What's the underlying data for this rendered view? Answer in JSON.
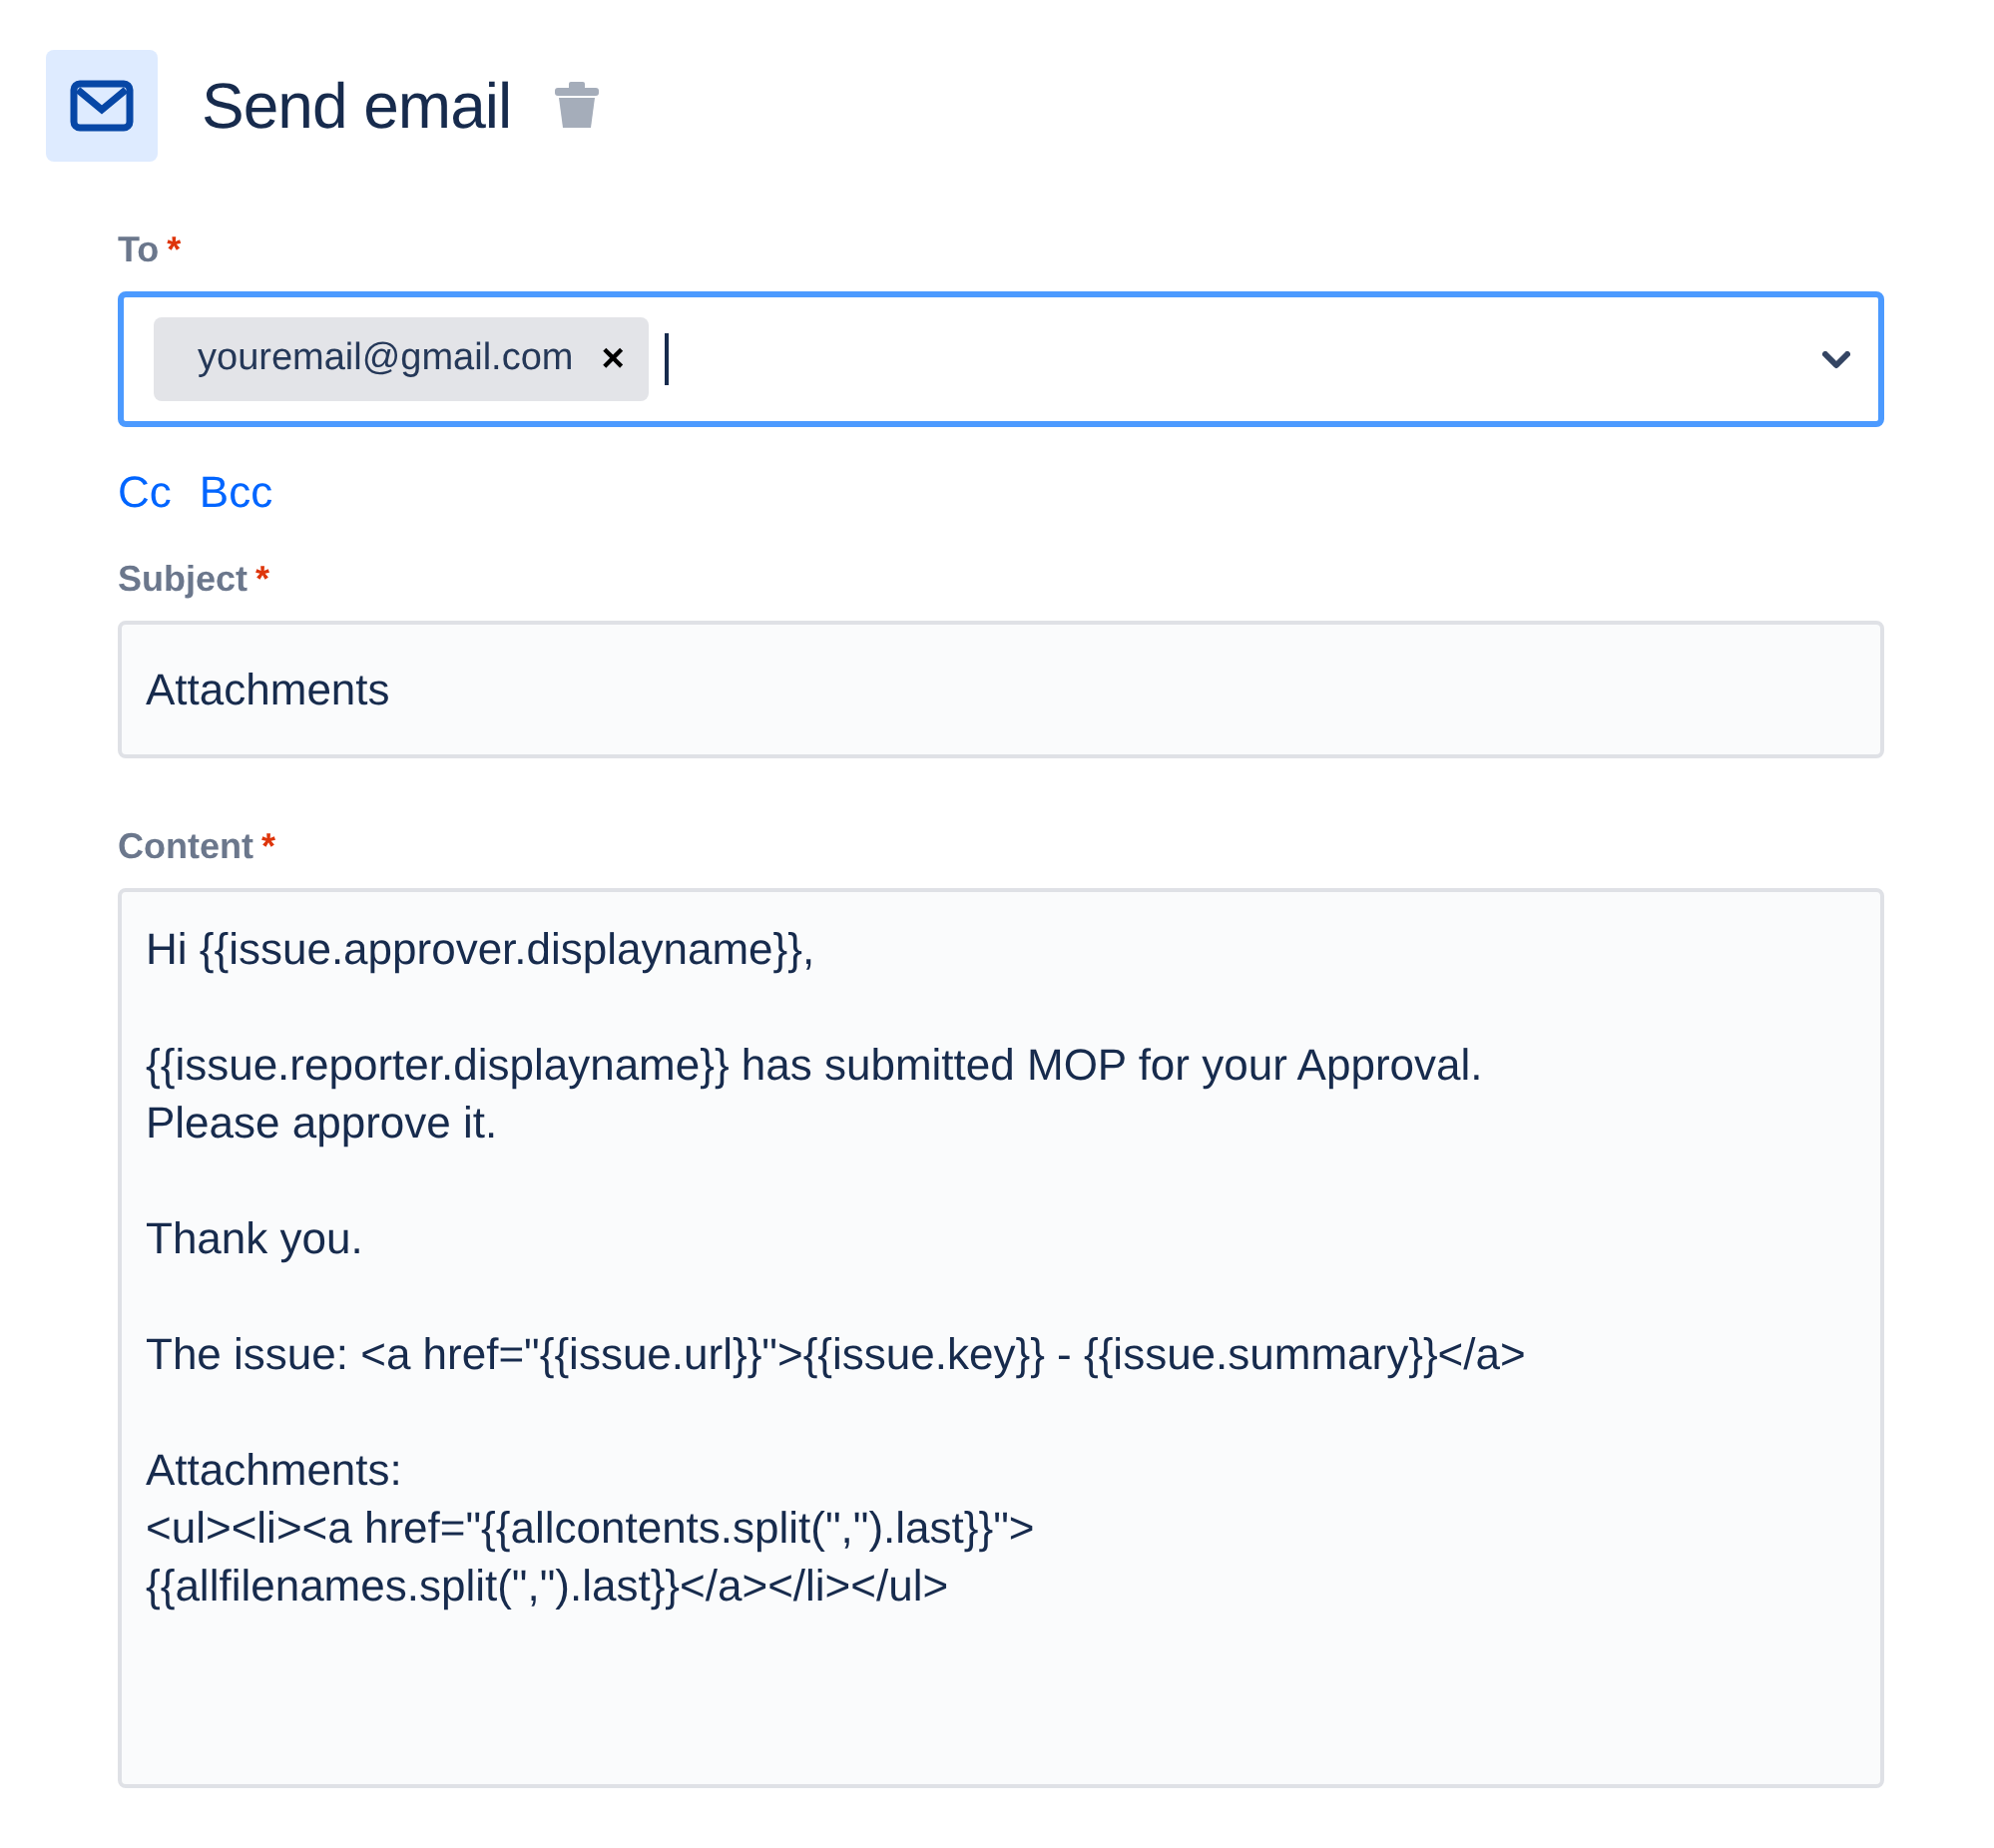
{
  "header": {
    "title": "Send email"
  },
  "to": {
    "label": "To",
    "required_mark": "*",
    "focused": true,
    "chips": [
      {
        "text": "youremail@gmail.com",
        "remove": "×"
      }
    ]
  },
  "links": [
    "Cc",
    "Bcc"
  ],
  "subject": {
    "label": "Subject",
    "required_mark": "*",
    "value": "Attachments"
  },
  "content": {
    "label": "Content",
    "required_mark": "*",
    "paragraphs": [
      [
        "Hi {{issue.approver.displayname}},"
      ],
      [
        "{{issue.reporter.displayname}} has submitted MOP for your Approval.",
        "Please approve it."
      ],
      [
        "Thank you."
      ],
      [
        "The issue: <a href=\"{{issue.url}}\">{{issue.key}} - {{issue.summary}}</a>"
      ],
      [
        "Attachments:",
        "<ul><li><a href=\"{{allcontents.split(\",\").last}}\">",
        "{{allfilenames.split(\",\").last}}</a></li></ul>"
      ]
    ]
  }
}
